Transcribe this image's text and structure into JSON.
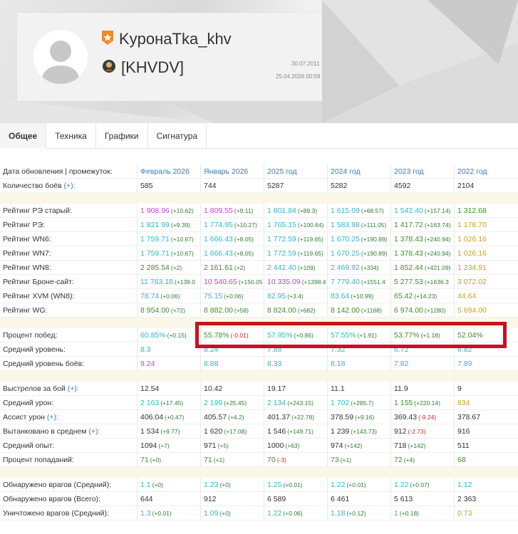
{
  "profile": {
    "nickname": "KypoнaTka_khv",
    "clan_tag": "[KHVDV]",
    "registered": "30.07.2011",
    "last_battle": "25.04.2026 00:59",
    "icons": {
      "badge": "star-badge-icon",
      "clan": "clan-emblem-icon",
      "avatar": "user-silhouette-icon"
    }
  },
  "tabs": [
    {
      "label": "Общее",
      "active": true
    },
    {
      "label": "Техника",
      "active": false
    },
    {
      "label": "Графики",
      "active": false
    },
    {
      "label": "Сигнатура",
      "active": false
    }
  ],
  "colors": {
    "accent": "#2f80c1",
    "highlight_border": "#c6121e",
    "separator_bg": "#fbf7e8"
  },
  "table": {
    "header": {
      "label": "Дата обновления | промежуток:",
      "columns": [
        "Февраль 2026",
        "Январь 2026",
        "2025 год",
        "2024 год",
        "2023 год",
        "2022 год"
      ]
    },
    "groups": [
      [
        {
          "label": "Количество боёв",
          "plus": true,
          "cells": [
            {
              "v": "585",
              "c": "dark"
            },
            {
              "v": "744",
              "c": "dark"
            },
            {
              "v": "5287",
              "c": "dark"
            },
            {
              "v": "5282",
              "c": "dark"
            },
            {
              "v": "4592",
              "c": "dark"
            },
            {
              "v": "2104",
              "c": "dark"
            }
          ]
        }
      ],
      [
        {
          "label": "Рейтинг РЭ старый:",
          "cells": [
            {
              "v": "1 908.96",
              "d": "(+10.62)",
              "c": "purple"
            },
            {
              "v": "1 809.55",
              "d": "(+9.11)",
              "c": "purple"
            },
            {
              "v": "1 801.84",
              "d": "(+89.3)",
              "c": "teal"
            },
            {
              "v": "1 615.09",
              "d": "(+68.57)",
              "c": "teal"
            },
            {
              "v": "1 542.40",
              "d": "(+157.14)",
              "c": "teal"
            },
            {
              "v": "1 312.68",
              "c": "green"
            }
          ]
        },
        {
          "label": "Рейтинг РЭ:",
          "cells": [
            {
              "v": "1 821.99",
              "d": "(+9.39)",
              "c": "teal"
            },
            {
              "v": "1 774.95",
              "d": "(+10.27)",
              "c": "teal"
            },
            {
              "v": "1 765.15",
              "d": "(+100.64)",
              "c": "teal"
            },
            {
              "v": "1 583.98",
              "d": "(+111.05)",
              "c": "teal"
            },
            {
              "v": "1 417.72",
              "d": "(+163.74)",
              "c": "green"
            },
            {
              "v": "1 178.70",
              "c": "gold"
            }
          ]
        },
        {
          "label": "Рейтинг WN6:",
          "cells": [
            {
              "v": "1 759.71",
              "d": "(+10.67)",
              "c": "teal"
            },
            {
              "v": "1 666.43",
              "d": "(+8.05)",
              "c": "teal"
            },
            {
              "v": "1 772.59",
              "d": "(+119.65)",
              "c": "teal"
            },
            {
              "v": "1 670.25",
              "d": "(+190.89)",
              "c": "teal"
            },
            {
              "v": "1 378.43",
              "d": "(+240.94)",
              "c": "green"
            },
            {
              "v": "1 026.16",
              "c": "gold"
            }
          ]
        },
        {
          "label": "Рейтинг WN7:",
          "cells": [
            {
              "v": "1 759.71",
              "d": "(+10.67)",
              "c": "teal"
            },
            {
              "v": "1 666.43",
              "d": "(+8.05)",
              "c": "teal"
            },
            {
              "v": "1 772.59",
              "d": "(+119.65)",
              "c": "teal"
            },
            {
              "v": "1 670.25",
              "d": "(+190.89)",
              "c": "teal"
            },
            {
              "v": "1 378.43",
              "d": "(+240.94)",
              "c": "green"
            },
            {
              "v": "1 026.16",
              "c": "gold"
            }
          ]
        },
        {
          "label": "Рейтинг WN8:",
          "cells": [
            {
              "v": "2 285.54",
              "d": "(+2)",
              "c": "green"
            },
            {
              "v": "2 161.61",
              "d": "(+2)",
              "c": "green"
            },
            {
              "v": "2 442.40",
              "d": "(+109)",
              "c": "teal"
            },
            {
              "v": "2 469.92",
              "d": "(+334)",
              "c": "teal"
            },
            {
              "v": "1 852.44",
              "d": "(+421.09)",
              "c": "green"
            },
            {
              "v": "1 234.91",
              "c": "gold"
            }
          ]
        },
        {
          "label": "Рейтинг Броне-сайт:",
          "cells": [
            {
              "v": "11 763.18",
              "d": "(+139.0",
              "c": "teal"
            },
            {
              "v": "10 540.65",
              "d": "(+150.05",
              "c": "purple"
            },
            {
              "v": "10 335.09",
              "d": "(+1398.4",
              "c": "purple"
            },
            {
              "v": "7 779.40",
              "d": "(+1551.4",
              "c": "teal"
            },
            {
              "v": "5 277.53",
              "d": "(+1636.3",
              "c": "green"
            },
            {
              "v": "3 072.02",
              "c": "gold"
            }
          ]
        },
        {
          "label": "Рейтинг XVM (WN8):",
          "cells": [
            {
              "v": "78.74",
              "d": "(+0.06)",
              "c": "teal"
            },
            {
              "v": "75.15",
              "d": "(+0.06)",
              "c": "teal"
            },
            {
              "v": "82.95",
              "d": "(+3.4)",
              "c": "teal"
            },
            {
              "v": "83.64",
              "d": "(+10.99)",
              "c": "teal"
            },
            {
              "v": "65.42",
              "d": "(+14.23)",
              "c": "green"
            },
            {
              "v": "44.64",
              "c": "gold"
            }
          ]
        },
        {
          "label": "Рейтинг WG:",
          "cells": [
            {
              "v": "8 954.00",
              "d": "(+72)",
              "c": "green"
            },
            {
              "v": "8 882.00",
              "d": "(+58)",
              "c": "green"
            },
            {
              "v": "8 824.00",
              "d": "(+682)",
              "c": "green"
            },
            {
              "v": "8 142.00",
              "d": "(+1168)",
              "c": "green"
            },
            {
              "v": "6 974.00",
              "d": "(+1280)",
              "c": "green"
            },
            {
              "v": "5 694.00",
              "c": "gold"
            }
          ]
        }
      ],
      [
        {
          "label": "Процент побед:",
          "cells": [
            {
              "v": "60.85%",
              "d": "(+0.15)",
              "c": "teal"
            },
            {
              "v": "55.78%",
              "d": "(-0.01)",
              "c": "green",
              "neg": true
            },
            {
              "v": "57.95%",
              "d": "(+0.86)",
              "c": "teal"
            },
            {
              "v": "57.55%",
              "d": "(+1.91)",
              "c": "teal"
            },
            {
              "v": "53.77%",
              "d": "(+1.18)",
              "c": "green"
            },
            {
              "v": "52.04%",
              "c": "green"
            }
          ]
        },
        {
          "label": "Средний уровень:",
          "cells": [
            {
              "v": "8.3",
              "c": "teal"
            },
            {
              "v": "8.24",
              "c": "teal"
            },
            {
              "v": "7.88",
              "c": "teal"
            },
            {
              "v": "7.32",
              "c": "teal"
            },
            {
              "v": "6.72",
              "c": "teal"
            },
            {
              "v": "6.82",
              "c": "teal"
            }
          ]
        },
        {
          "label": "Средний уровень боёв:",
          "cells": [
            {
              "v": "9.24",
              "c": "purple"
            },
            {
              "v": "8.88",
              "c": "teal"
            },
            {
              "v": "8.33",
              "c": "teal"
            },
            {
              "v": "8.18",
              "c": "teal"
            },
            {
              "v": "7.82",
              "c": "teal"
            },
            {
              "v": "7.89",
              "c": "teal"
            }
          ]
        }
      ],
      [
        {
          "label": "Выстрелов за бой",
          "plus": true,
          "cells": [
            {
              "v": "12.54",
              "c": "dark"
            },
            {
              "v": "10.42",
              "c": "dark"
            },
            {
              "v": "19.17",
              "c": "dark"
            },
            {
              "v": "11.1",
              "c": "dark"
            },
            {
              "v": "11.9",
              "c": "dark"
            },
            {
              "v": "9",
              "c": "dark"
            }
          ]
        },
        {
          "label": "Средний урон:",
          "cells": [
            {
              "v": "2 163",
              "d": "(+17.45)",
              "c": "teal"
            },
            {
              "v": "2 199",
              "d": "(+25.45)",
              "c": "teal"
            },
            {
              "v": "2 134",
              "d": "(+243.15)",
              "c": "teal"
            },
            {
              "v": "1 702",
              "d": "(+285.7)",
              "c": "teal"
            },
            {
              "v": "1 155",
              "d": "(+220.14)",
              "c": "green"
            },
            {
              "v": "834",
              "c": "gold"
            }
          ]
        },
        {
          "label": "Ассист урон",
          "plus": true,
          "cells": [
            {
              "v": "406.04",
              "d": "(+0.47)",
              "c": "dark"
            },
            {
              "v": "405.57",
              "d": "(+4.2)",
              "c": "dark"
            },
            {
              "v": "401.37",
              "d": "(+22.78)",
              "c": "dark"
            },
            {
              "v": "378.59",
              "d": "(+9.16)",
              "c": "dark"
            },
            {
              "v": "369.43",
              "d": "(-9.24)",
              "c": "dark",
              "neg": true
            },
            {
              "v": "378.67",
              "c": "dark"
            }
          ]
        },
        {
          "label": "Вытанковано в среднем",
          "plus": true,
          "cells": [
            {
              "v": "1 534",
              "d": "(+9.77)",
              "c": "dark"
            },
            {
              "v": "1 620",
              "d": "(+17.08)",
              "c": "dark"
            },
            {
              "v": "1 546",
              "d": "(+149.71)",
              "c": "dark"
            },
            {
              "v": "1 239",
              "d": "(+143.73)",
              "c": "dark"
            },
            {
              "v": "912",
              "d": "(-2.73)",
              "c": "dark",
              "neg": true
            },
            {
              "v": "916",
              "c": "dark"
            }
          ]
        },
        {
          "label": "Средний опыт:",
          "cells": [
            {
              "v": "1094",
              "d": "(+7)",
              "c": "dark"
            },
            {
              "v": "971",
              "d": "(+5)",
              "c": "dark"
            },
            {
              "v": "1000",
              "d": "(+63)",
              "c": "dark"
            },
            {
              "v": "974",
              "d": "(+142)",
              "c": "dark"
            },
            {
              "v": "718",
              "d": "(+142)",
              "c": "dark"
            },
            {
              "v": "511",
              "c": "dark"
            }
          ]
        },
        {
          "label": "Процент попаданий:",
          "cells": [
            {
              "v": "71",
              "d": "(+0)",
              "c": "green"
            },
            {
              "v": "71",
              "d": "(+1)",
              "c": "green"
            },
            {
              "v": "70",
              "d": "(-3)",
              "c": "green",
              "neg": true
            },
            {
              "v": "73",
              "d": "(+1)",
              "c": "green"
            },
            {
              "v": "72",
              "d": "(+4)",
              "c": "green"
            },
            {
              "v": "68",
              "c": "green"
            }
          ]
        }
      ],
      [
        {
          "label": "Обнаружено врагов (Средний):",
          "cells": [
            {
              "v": "1.1",
              "d": "(+0)",
              "c": "teal"
            },
            {
              "v": "1.23",
              "d": "(+0)",
              "c": "teal"
            },
            {
              "v": "1.25",
              "d": "(+0.01)",
              "c": "teal"
            },
            {
              "v": "1.22",
              "d": "(+0.01)",
              "c": "teal"
            },
            {
              "v": "1.22",
              "d": "(+0.07)",
              "c": "teal"
            },
            {
              "v": "1.12",
              "c": "teal"
            }
          ]
        },
        {
          "label": "Обнаружено врагов (Всего):",
          "cells": [
            {
              "v": "644",
              "c": "dark"
            },
            {
              "v": "912",
              "c": "dark"
            },
            {
              "v": "6 589",
              "c": "dark"
            },
            {
              "v": "6 461",
              "c": "dark"
            },
            {
              "v": "5 613",
              "c": "dark"
            },
            {
              "v": "2 363",
              "c": "dark"
            }
          ]
        },
        {
          "label": "Уничтожено врагов (Средний):",
          "cells": [
            {
              "v": "1.3",
              "d": "(+0.01)",
              "c": "teal"
            },
            {
              "v": "1.09",
              "d": "(+0)",
              "c": "teal"
            },
            {
              "v": "1.22",
              "d": "(+0.06)",
              "c": "teal"
            },
            {
              "v": "1.18",
              "d": "(+0.12)",
              "c": "teal"
            },
            {
              "v": "1",
              "d": "(+0.18)",
              "c": "teal"
            },
            {
              "v": "0.73",
              "c": "gold"
            }
          ]
        }
      ]
    ]
  }
}
